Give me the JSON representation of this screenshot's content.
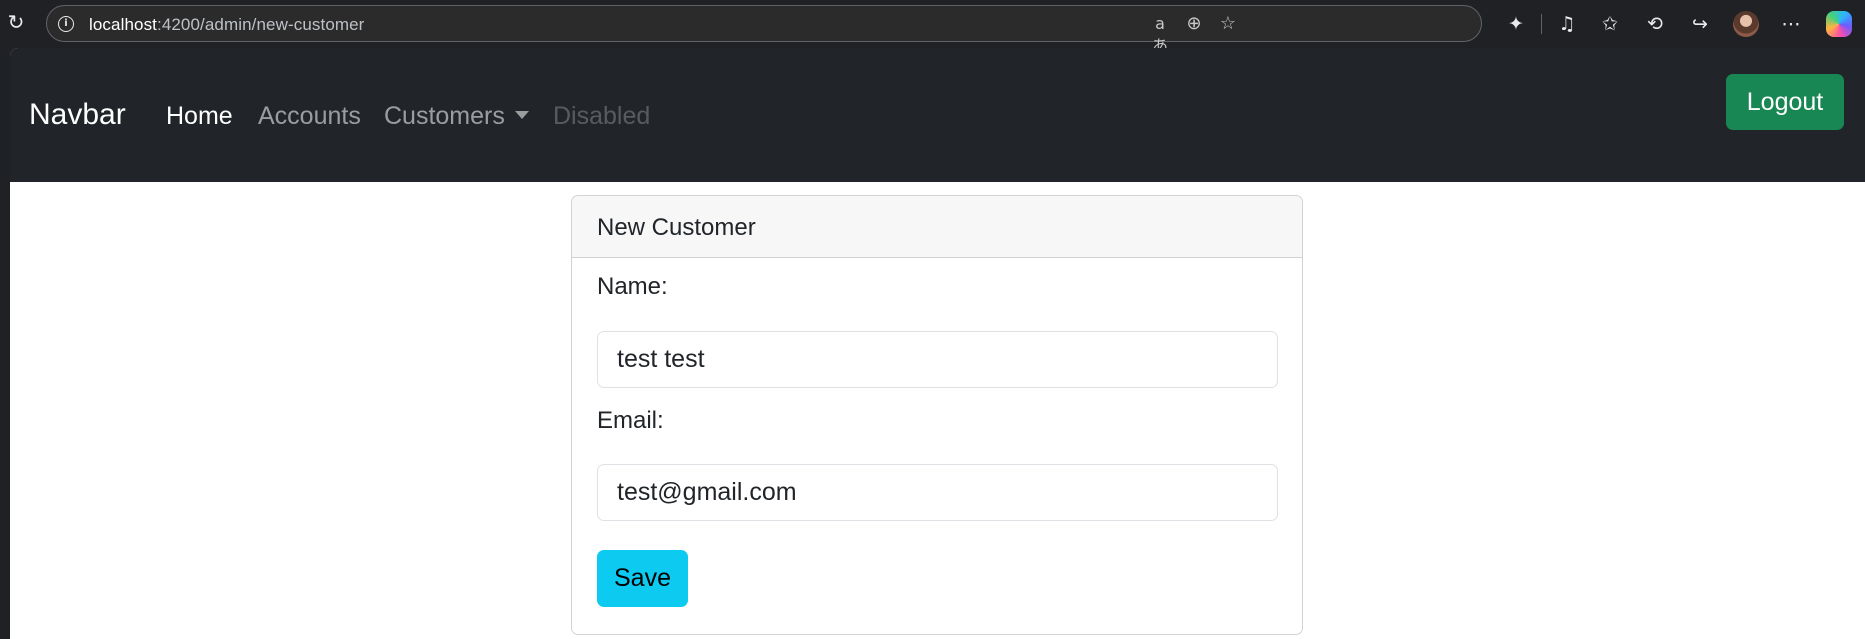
{
  "browser": {
    "url_host": "localhost",
    "url_rest": ":4200/admin/new-customer",
    "icons": {
      "reload": "reload-icon",
      "site_info": "info-icon",
      "read_aloud": "read-aloud-icon",
      "zoom": "zoom-icon",
      "favorite": "star-icon",
      "extensions": "puzzle-icon",
      "media": "music-icon",
      "favorites": "favorites-icon",
      "history": "history-icon",
      "share": "share-icon",
      "more": "more-icon",
      "copilot": "copilot-icon"
    }
  },
  "navbar": {
    "brand": "Navbar",
    "links": [
      {
        "label": "Home",
        "state": "active"
      },
      {
        "label": "Accounts",
        "state": "normal"
      },
      {
        "label": "Customers",
        "state": "dropdown"
      },
      {
        "label": "Disabled",
        "state": "disabled"
      }
    ],
    "logout_label": "Logout",
    "colors": {
      "background": "#212529",
      "logout": "#198754"
    }
  },
  "card": {
    "title": "New Customer",
    "name_label": "Name:",
    "name_value": "test test",
    "email_label": "Email:",
    "email_value": "test@gmail.com",
    "save_label": "Save",
    "colors": {
      "save": "#0dcaf0"
    }
  }
}
